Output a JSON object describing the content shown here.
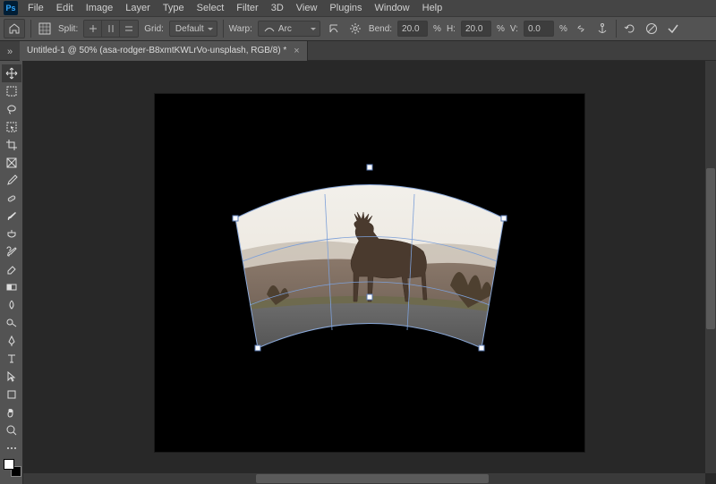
{
  "app": {
    "logo_text": "Ps"
  },
  "menu": [
    "File",
    "Edit",
    "Image",
    "Layer",
    "Type",
    "Select",
    "Filter",
    "3D",
    "View",
    "Plugins",
    "Window",
    "Help"
  ],
  "options": {
    "split_label": "Split:",
    "grid_label": "Grid:",
    "grid_value": "Default",
    "warp_label": "Warp:",
    "warp_value": "Arc",
    "bend_label": "Bend:",
    "bend_value": "20.0",
    "bend_unit": "%",
    "h_label": "H:",
    "h_value": "20.0",
    "h_unit": "%",
    "v_label": "V:",
    "v_value": "0.0",
    "v_unit": "%"
  },
  "document": {
    "tab_title": "Untitled-1 @ 50% (asa-rodger-B8xmtKWLrVo-unsplash, RGB/8) *"
  }
}
